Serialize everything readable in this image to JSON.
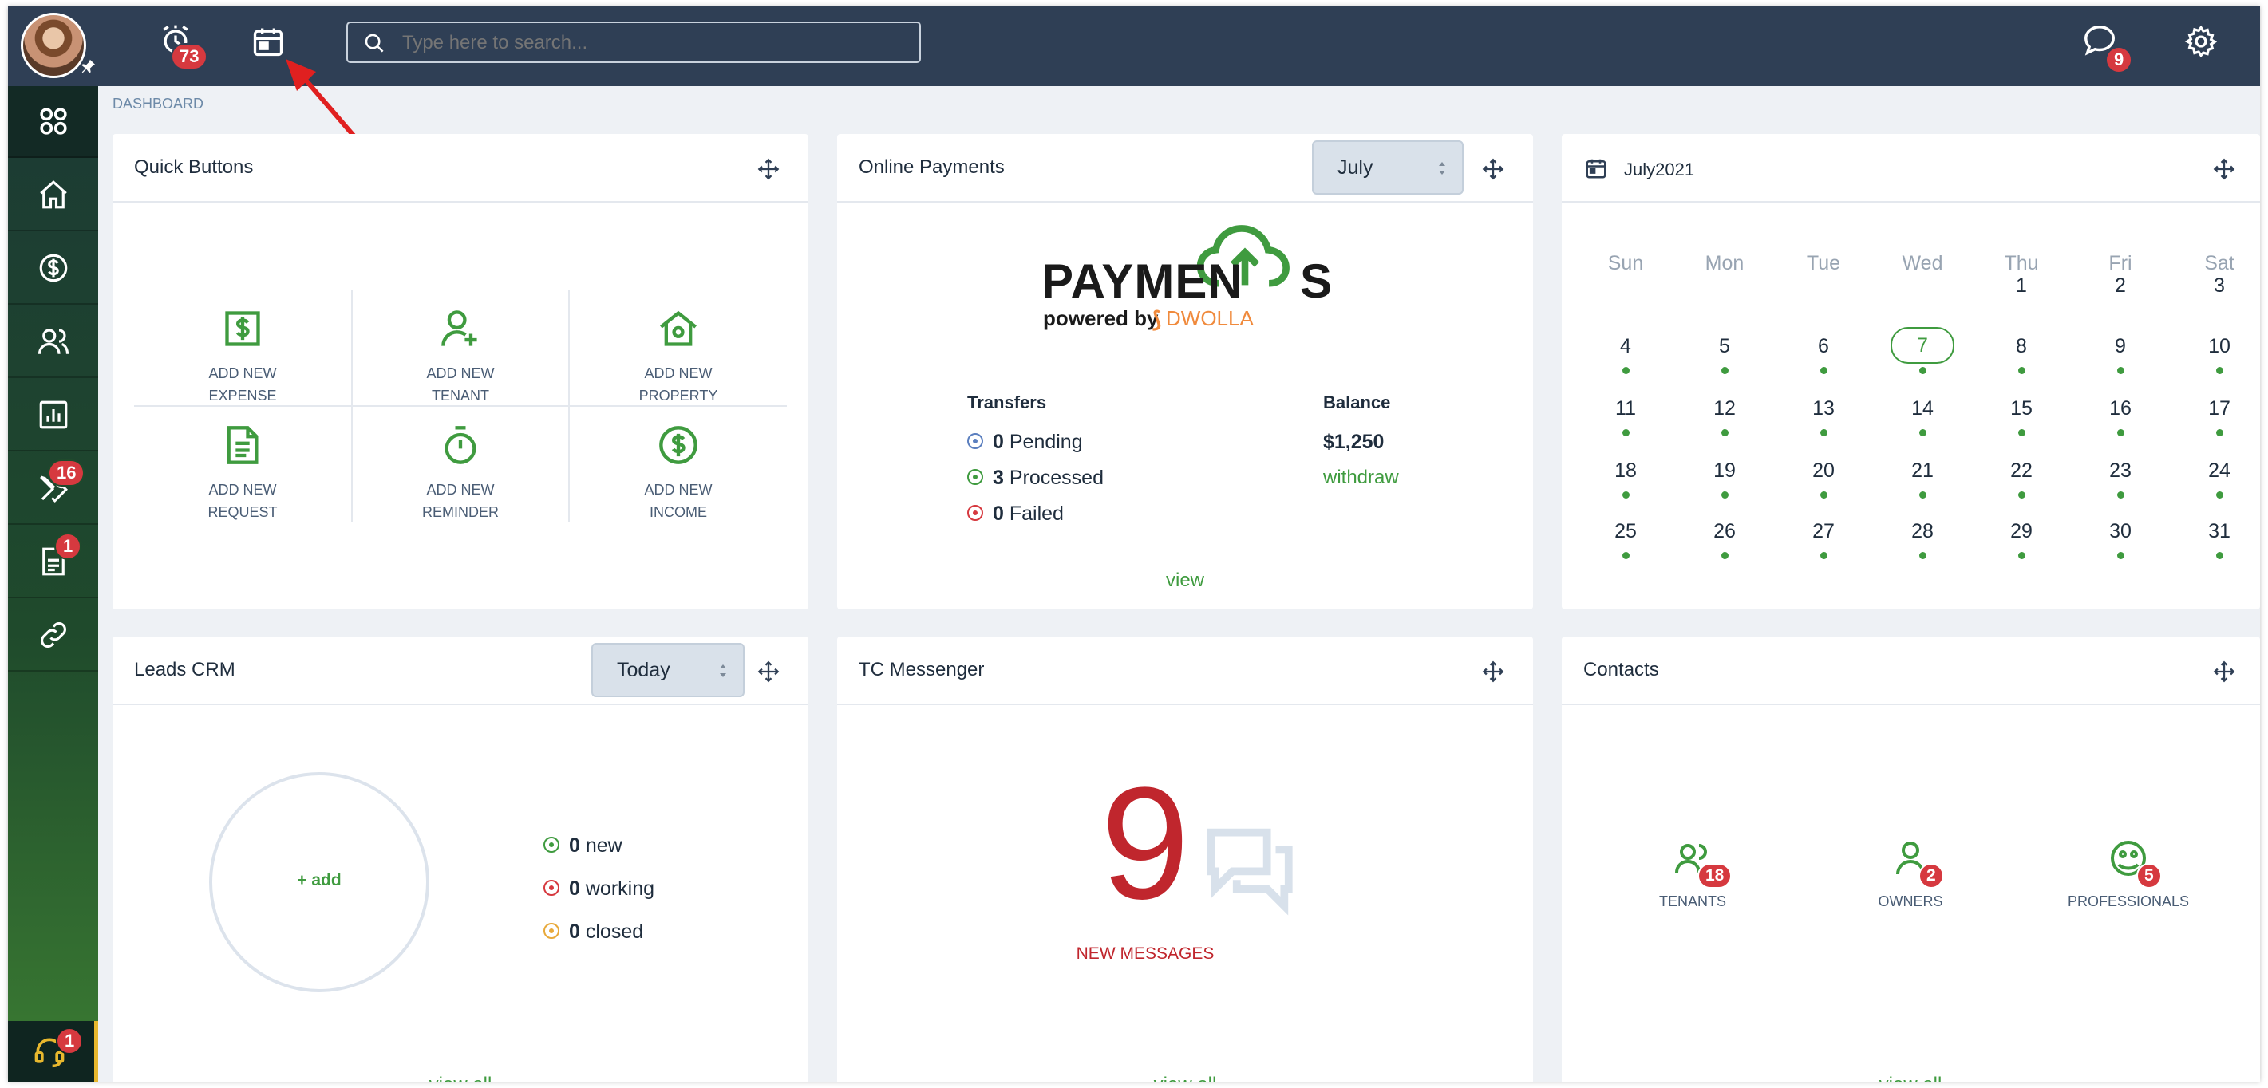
{
  "topbar": {
    "reminders_badge": "73",
    "search_placeholder": "Type here to search...",
    "messages_badge": "9"
  },
  "sidebar": {
    "items": [
      {
        "icon": "grid-icon"
      },
      {
        "icon": "home-icon"
      },
      {
        "icon": "dollar-icon"
      },
      {
        "icon": "users-icon"
      },
      {
        "icon": "chart-icon"
      },
      {
        "icon": "tools-icon",
        "badge": "16"
      },
      {
        "icon": "document-icon",
        "badge": "1"
      },
      {
        "icon": "link-icon"
      }
    ],
    "support_badge": "1"
  },
  "breadcrumb": "DASHBOARD",
  "quick_buttons": {
    "title": "Quick Buttons",
    "items": [
      {
        "line1": "ADD NEW",
        "line2": "EXPENSE",
        "icon": "expense-icon"
      },
      {
        "line1": "ADD NEW",
        "line2": "TENANT",
        "icon": "add-user-icon"
      },
      {
        "line1": "ADD NEW",
        "line2": "PROPERTY",
        "icon": "property-icon"
      },
      {
        "line1": "ADD NEW",
        "line2": "REQUEST",
        "icon": "request-icon"
      },
      {
        "line1": "ADD NEW",
        "line2": "REMINDER",
        "icon": "stopwatch-icon"
      },
      {
        "line1": "ADD NEW",
        "line2": "INCOME",
        "icon": "income-icon"
      }
    ]
  },
  "online_payments": {
    "title": "Online Payments",
    "month": "July",
    "logo_word": "PAYMEN",
    "logo_word_end": "S",
    "logo_powered": "powered by",
    "logo_brand": "DWOLLA",
    "transfers_label": "Transfers",
    "balance_label": "Balance",
    "pending_count": "0",
    "pending_label": "Pending",
    "processed_count": "3",
    "processed_label": "Processed",
    "failed_count": "0",
    "failed_label": "Failed",
    "balance": "$1,250",
    "withdraw": "withdraw",
    "view": "view"
  },
  "calendar": {
    "title": "July2021",
    "weekdays": [
      "Sun",
      "Mon",
      "Tue",
      "Wed",
      "Thu",
      "Fri",
      "Sat"
    ],
    "today": 7
  },
  "leads": {
    "title": "Leads CRM",
    "period": "Today",
    "add": "+ add",
    "new_count": "0",
    "new_label": "new",
    "working_count": "0",
    "working_label": "working",
    "closed_count": "0",
    "closed_label": "closed",
    "view_all": "view all"
  },
  "messenger": {
    "title": "TC Messenger",
    "count": "9",
    "label": "NEW MESSAGES",
    "view_all": "view all"
  },
  "contacts": {
    "title": "Contacts",
    "items": [
      {
        "label": "TENANTS",
        "badge": "18",
        "icon": "tenants-icon"
      },
      {
        "label": "OWNERS",
        "badge": "2",
        "icon": "owners-icon"
      },
      {
        "label": "PROFESSIONALS",
        "badge": "5",
        "icon": "professionals-icon"
      }
    ],
    "view_all": "view all"
  },
  "colors": {
    "topbar": "#2f3f55",
    "accent_green": "#3f9b3f",
    "badge_red": "#d6393f",
    "messages_red": "#c0262d",
    "dwolla_orange": "#f08a3c"
  }
}
